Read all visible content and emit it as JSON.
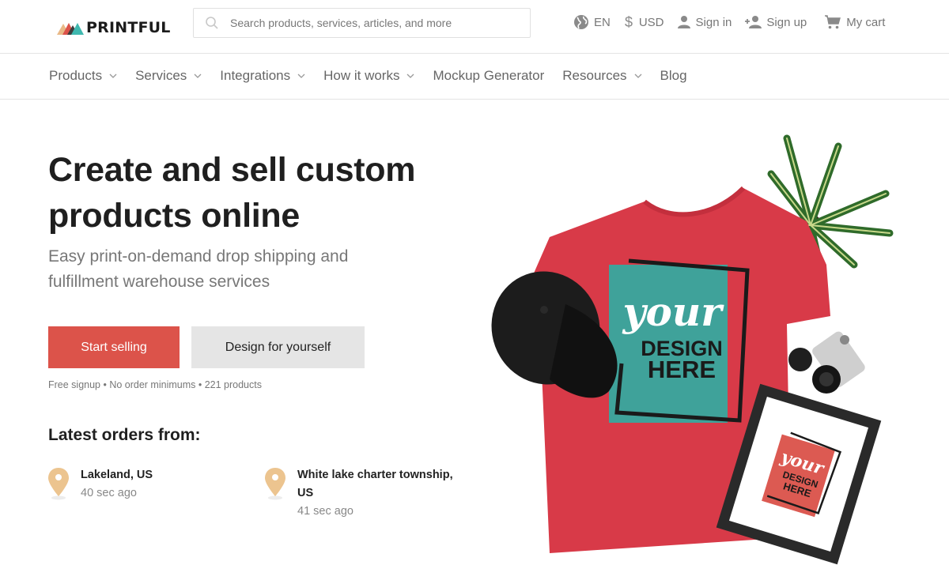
{
  "brand": {
    "name": "PRINTFUL",
    "logo_colors": [
      "#e9b987",
      "#dc534a",
      "#3d3d3d",
      "#3fb8af"
    ]
  },
  "search": {
    "placeholder": "Search products, services, articles, and more",
    "value": ""
  },
  "utilities": [
    {
      "icon": "globe-icon",
      "label": "EN"
    },
    {
      "icon": "dollar-icon",
      "label": "USD"
    },
    {
      "icon": "user-icon",
      "label": "Sign in"
    },
    {
      "icon": "add-user-icon",
      "label": "Sign up"
    },
    {
      "icon": "cart-icon",
      "label": "My cart"
    }
  ],
  "nav": [
    {
      "label": "Products",
      "has_dropdown": true
    },
    {
      "label": "Services",
      "has_dropdown": true
    },
    {
      "label": "Integrations",
      "has_dropdown": true
    },
    {
      "label": "How it works",
      "has_dropdown": true
    },
    {
      "label": "Mockup Generator",
      "has_dropdown": false
    },
    {
      "label": "Resources",
      "has_dropdown": true
    },
    {
      "label": "Blog",
      "has_dropdown": false
    }
  ],
  "hero": {
    "title": "Create and sell custom products online",
    "subtitle": "Easy print-on-demand drop shipping and fulfillment warehouse services",
    "primary_cta": "Start selling",
    "secondary_cta": "Design for yourself",
    "perks": "Free signup • No order minimums • 221 products",
    "image_alt": "Red t-shirt, black cap, framed poster and camera with 'your DESIGN HERE' print",
    "design_text": {
      "script": "your",
      "line1": "DESIGN",
      "line2": "HERE"
    }
  },
  "latest_orders": {
    "title": "Latest orders from:",
    "items": [
      {
        "city": "Lakeland, US",
        "time": "40 sec ago"
      },
      {
        "city": "White lake charter township, US",
        "time": "41 sec ago"
      }
    ]
  },
  "colors": {
    "accent": "#dc534a",
    "secondary_button": "#e5e5e5",
    "pin": "#ecc48f",
    "teal": "#3fa29a",
    "shirt": "#d83a48"
  }
}
